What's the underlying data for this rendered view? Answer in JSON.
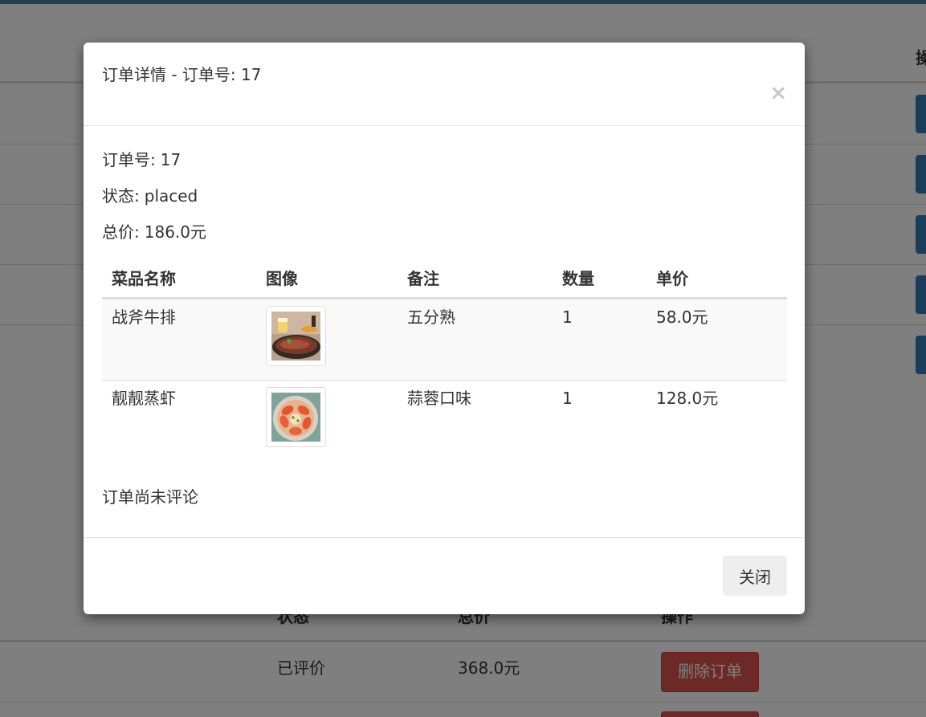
{
  "background": {
    "top_table": {
      "header_partial": "操"
    },
    "bottom_table": {
      "headers": {
        "status": "状态",
        "total": "总价",
        "action": "操作"
      },
      "rows": [
        {
          "status": "已评价",
          "total": "368.0元",
          "action": "删除订单"
        },
        {
          "status": "",
          "total": "",
          "action": ""
        }
      ]
    }
  },
  "modal": {
    "title": "订单详情 - 订单号: 17",
    "close_symbol": "×",
    "order_no_label": "订单号:",
    "order_no": "17",
    "status_label": "状态:",
    "status": "placed",
    "total_label": "总价:",
    "total": "186.0元",
    "table": {
      "headers": [
        "菜品名称",
        "图像",
        "备注",
        "数量",
        "单价"
      ],
      "rows": [
        {
          "name": "战斧牛排",
          "image_icon": "steak-photo",
          "note": "五分熟",
          "qty": "1",
          "price": "58.0元"
        },
        {
          "name": "靓靓蒸虾",
          "image_icon": "shrimp-photo",
          "note": "蒜蓉口味",
          "qty": "1",
          "price": "128.0元"
        }
      ]
    },
    "review_status": "订单尚未评论",
    "footer": {
      "close_label": "关闭"
    }
  },
  "colors": {
    "accent_strip": "#3e7f96",
    "primary_button": "#337ab7",
    "danger_button": "#d9534f"
  }
}
